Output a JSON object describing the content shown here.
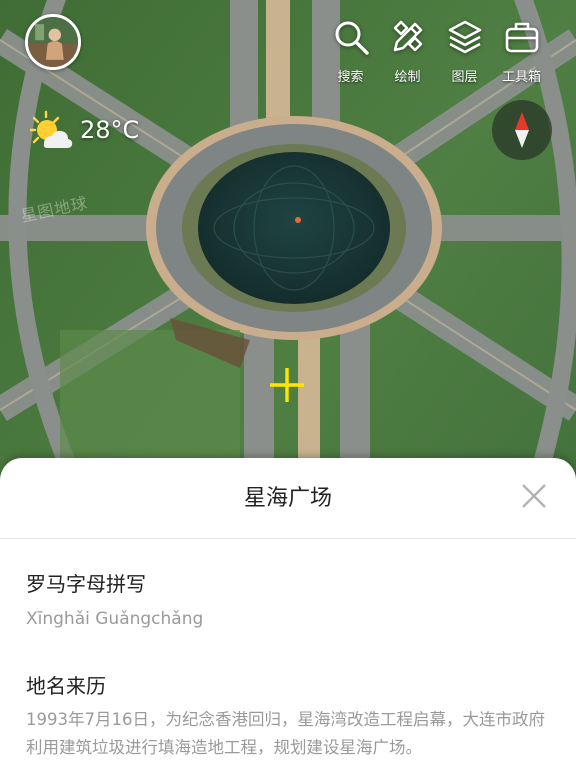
{
  "weather": {
    "temperature": "28°C",
    "icon": "partly-sunny-icon"
  },
  "toolbar": {
    "items": [
      {
        "label": "搜索",
        "icon": "search-icon"
      },
      {
        "label": "绘制",
        "icon": "draw-icon"
      },
      {
        "label": "图层",
        "icon": "layers-icon"
      },
      {
        "label": "工具箱",
        "icon": "toolbox-icon"
      }
    ]
  },
  "watermark": "星图地球",
  "sheet": {
    "title": "星海广场",
    "sections": [
      {
        "heading": "罗马字母拼写",
        "value": "Xīnghǎi Guǎngchǎng"
      },
      {
        "heading": "地名来历",
        "value": "1993年7月16日，为纪念香港回归，星海湾改造工程启幕，大连市政府利用建筑垃圾进行填海造地工程，规划建设星海广场。"
      }
    ]
  },
  "colors": {
    "crosshair": "#ffe600",
    "compass_north": "#e23b2e",
    "grass": "#4c7a40",
    "pond": "#1c3b3a"
  }
}
